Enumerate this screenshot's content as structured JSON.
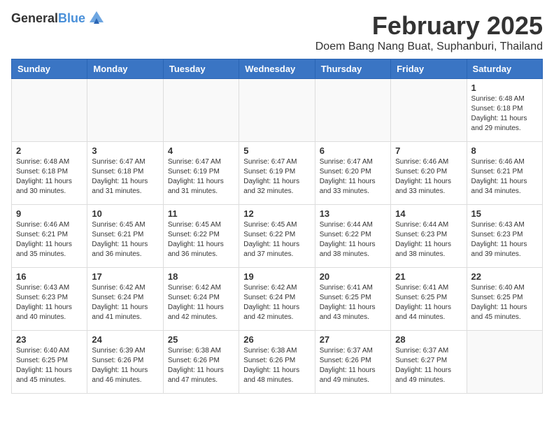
{
  "logo": {
    "general": "General",
    "blue": "Blue"
  },
  "header": {
    "month": "February 2025",
    "location": "Doem Bang Nang Buat, Suphanburi, Thailand"
  },
  "weekdays": [
    "Sunday",
    "Monday",
    "Tuesday",
    "Wednesday",
    "Thursday",
    "Friday",
    "Saturday"
  ],
  "weeks": [
    [
      {
        "day": "",
        "info": ""
      },
      {
        "day": "",
        "info": ""
      },
      {
        "day": "",
        "info": ""
      },
      {
        "day": "",
        "info": ""
      },
      {
        "day": "",
        "info": ""
      },
      {
        "day": "",
        "info": ""
      },
      {
        "day": "1",
        "info": "Sunrise: 6:48 AM\nSunset: 6:18 PM\nDaylight: 11 hours and 29 minutes."
      }
    ],
    [
      {
        "day": "2",
        "info": "Sunrise: 6:48 AM\nSunset: 6:18 PM\nDaylight: 11 hours and 30 minutes."
      },
      {
        "day": "3",
        "info": "Sunrise: 6:47 AM\nSunset: 6:18 PM\nDaylight: 11 hours and 31 minutes."
      },
      {
        "day": "4",
        "info": "Sunrise: 6:47 AM\nSunset: 6:19 PM\nDaylight: 11 hours and 31 minutes."
      },
      {
        "day": "5",
        "info": "Sunrise: 6:47 AM\nSunset: 6:19 PM\nDaylight: 11 hours and 32 minutes."
      },
      {
        "day": "6",
        "info": "Sunrise: 6:47 AM\nSunset: 6:20 PM\nDaylight: 11 hours and 33 minutes."
      },
      {
        "day": "7",
        "info": "Sunrise: 6:46 AM\nSunset: 6:20 PM\nDaylight: 11 hours and 33 minutes."
      },
      {
        "day": "8",
        "info": "Sunrise: 6:46 AM\nSunset: 6:21 PM\nDaylight: 11 hours and 34 minutes."
      }
    ],
    [
      {
        "day": "9",
        "info": "Sunrise: 6:46 AM\nSunset: 6:21 PM\nDaylight: 11 hours and 35 minutes."
      },
      {
        "day": "10",
        "info": "Sunrise: 6:45 AM\nSunset: 6:21 PM\nDaylight: 11 hours and 36 minutes."
      },
      {
        "day": "11",
        "info": "Sunrise: 6:45 AM\nSunset: 6:22 PM\nDaylight: 11 hours and 36 minutes."
      },
      {
        "day": "12",
        "info": "Sunrise: 6:45 AM\nSunset: 6:22 PM\nDaylight: 11 hours and 37 minutes."
      },
      {
        "day": "13",
        "info": "Sunrise: 6:44 AM\nSunset: 6:22 PM\nDaylight: 11 hours and 38 minutes."
      },
      {
        "day": "14",
        "info": "Sunrise: 6:44 AM\nSunset: 6:23 PM\nDaylight: 11 hours and 38 minutes."
      },
      {
        "day": "15",
        "info": "Sunrise: 6:43 AM\nSunset: 6:23 PM\nDaylight: 11 hours and 39 minutes."
      }
    ],
    [
      {
        "day": "16",
        "info": "Sunrise: 6:43 AM\nSunset: 6:23 PM\nDaylight: 11 hours and 40 minutes."
      },
      {
        "day": "17",
        "info": "Sunrise: 6:42 AM\nSunset: 6:24 PM\nDaylight: 11 hours and 41 minutes."
      },
      {
        "day": "18",
        "info": "Sunrise: 6:42 AM\nSunset: 6:24 PM\nDaylight: 11 hours and 42 minutes."
      },
      {
        "day": "19",
        "info": "Sunrise: 6:42 AM\nSunset: 6:24 PM\nDaylight: 11 hours and 42 minutes."
      },
      {
        "day": "20",
        "info": "Sunrise: 6:41 AM\nSunset: 6:25 PM\nDaylight: 11 hours and 43 minutes."
      },
      {
        "day": "21",
        "info": "Sunrise: 6:41 AM\nSunset: 6:25 PM\nDaylight: 11 hours and 44 minutes."
      },
      {
        "day": "22",
        "info": "Sunrise: 6:40 AM\nSunset: 6:25 PM\nDaylight: 11 hours and 45 minutes."
      }
    ],
    [
      {
        "day": "23",
        "info": "Sunrise: 6:40 AM\nSunset: 6:25 PM\nDaylight: 11 hours and 45 minutes."
      },
      {
        "day": "24",
        "info": "Sunrise: 6:39 AM\nSunset: 6:26 PM\nDaylight: 11 hours and 46 minutes."
      },
      {
        "day": "25",
        "info": "Sunrise: 6:38 AM\nSunset: 6:26 PM\nDaylight: 11 hours and 47 minutes."
      },
      {
        "day": "26",
        "info": "Sunrise: 6:38 AM\nSunset: 6:26 PM\nDaylight: 11 hours and 48 minutes."
      },
      {
        "day": "27",
        "info": "Sunrise: 6:37 AM\nSunset: 6:26 PM\nDaylight: 11 hours and 49 minutes."
      },
      {
        "day": "28",
        "info": "Sunrise: 6:37 AM\nSunset: 6:27 PM\nDaylight: 11 hours and 49 minutes."
      },
      {
        "day": "",
        "info": ""
      }
    ]
  ]
}
